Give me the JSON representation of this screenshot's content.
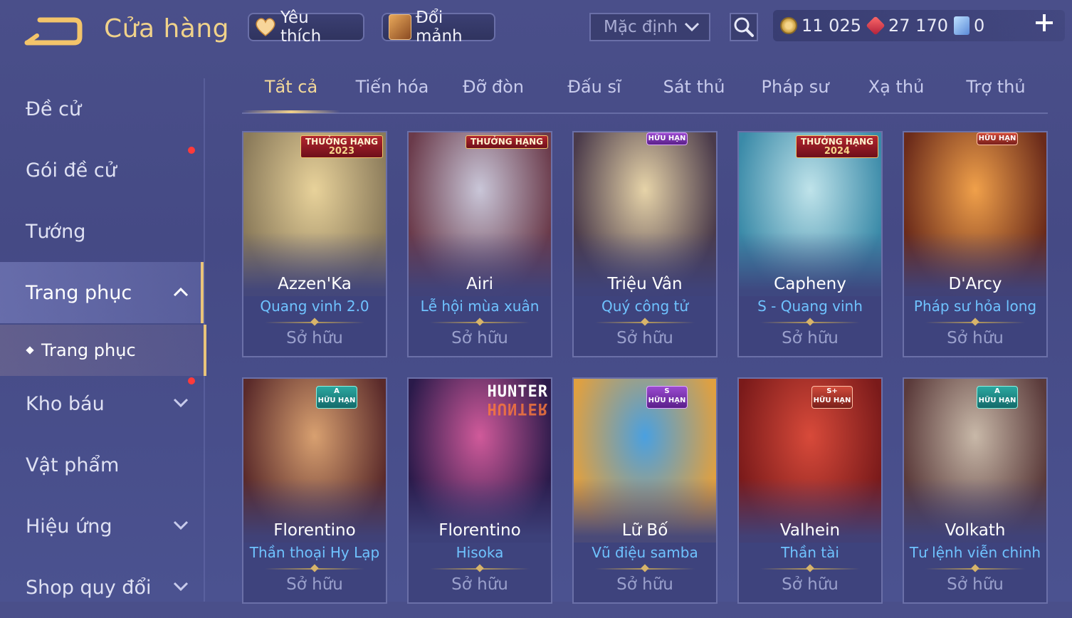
{
  "header": {
    "title": "Cửa hàng",
    "back_icon": "back-arrow-icon",
    "favorite_label": "Yêu thích",
    "shard_label": "Đổi mảnh",
    "sort_value": "Mặc định",
    "currencies": [
      {
        "icon": "gold-coin-icon",
        "value": "11 025"
      },
      {
        "icon": "ruby-voucher-icon",
        "value": "27 170"
      },
      {
        "icon": "quan-huy-icon",
        "value": "0"
      }
    ]
  },
  "sidebar": {
    "items": [
      {
        "label": "Đề cử"
      },
      {
        "label": "Gói đề cử"
      },
      {
        "label": "Tướng"
      },
      {
        "label": "Trang phục"
      },
      {
        "label": "Kho báu"
      },
      {
        "label": "Vật phẩm"
      },
      {
        "label": "Hiệu ứng"
      },
      {
        "label": "Shop quy đổi"
      }
    ],
    "sub_item": "Trang phục"
  },
  "tabs": [
    "Tất cả",
    "Tiến hóa",
    "Đỡ đòn",
    "Đấu sĩ",
    "Sát thủ",
    "Pháp sư",
    "Xạ thủ",
    "Trợ thủ"
  ],
  "cards": [
    {
      "hero": "Azzen'Ka",
      "skin": "Quang vinh 2.0",
      "status": "Sở hữu",
      "badge": "THƯỞNG HẠNG",
      "badge_year": "2023",
      "art": [
        "#e8d29a",
        "#8a7a5a"
      ]
    },
    {
      "hero": "Airi",
      "skin": "Lễ hội mùa xuân",
      "status": "Sở hữu",
      "badge": "THƯỞNG HẠNG",
      "badge_year": "",
      "art": [
        "#c9c6d8",
        "#6a3a4a"
      ]
    },
    {
      "hero": "Triệu Vân",
      "skin": "Quý công tử",
      "status": "Sở hữu",
      "badge": "",
      "tag": "HỮU HẠN",
      "art": [
        "#e6d3a8",
        "#4a3a4a"
      ]
    },
    {
      "hero": "Capheny",
      "skin": "S - Quang vinh",
      "status": "Sở hữu",
      "badge": "THƯỞNG HẠNG",
      "badge_year": "2024",
      "art": [
        "#bfe3ea",
        "#3a8aa8"
      ]
    },
    {
      "hero": "D'Arcy",
      "skin": "Pháp sư hỏa long",
      "status": "Sở hữu",
      "badge": "",
      "tag": "HỮU HẠN",
      "art": [
        "#f0a04a",
        "#6a2a1a"
      ]
    },
    {
      "hero": "Florentino",
      "skin": "Thần thoại Hy Lạp",
      "status": "Sở hữu",
      "tag_grade": "A",
      "tag": "HỮU HẠN",
      "art": [
        "#d8a070",
        "#5a2a2a"
      ]
    },
    {
      "hero": "Florentino",
      "skin": "Hisoka",
      "status": "Sở hữu",
      "hunter": [
        "HUNTER",
        "HUNTER"
      ],
      "art": [
        "#d05a9a",
        "#2a1a4a"
      ]
    },
    {
      "hero": "Lữ Bố",
      "skin": "Vũ điệu samba",
      "status": "Sở hữu",
      "tag_grade": "S",
      "tag": "HỮU HẠN",
      "art": [
        "#4aa0e0",
        "#e0a040"
      ]
    },
    {
      "hero": "Valhein",
      "skin": "Thần tài",
      "status": "Sở hữu",
      "tag_grade": "S+",
      "tag": "HỮU HẠN",
      "art": [
        "#d84a3a",
        "#7a1a1a"
      ]
    },
    {
      "hero": "Volkath",
      "skin": "Tư lệnh viễn chinh",
      "status": "Sở hữu",
      "tag_grade": "A",
      "tag": "HỮU HẠN",
      "art": [
        "#c8b8a8",
        "#5a3a3a"
      ]
    }
  ]
}
